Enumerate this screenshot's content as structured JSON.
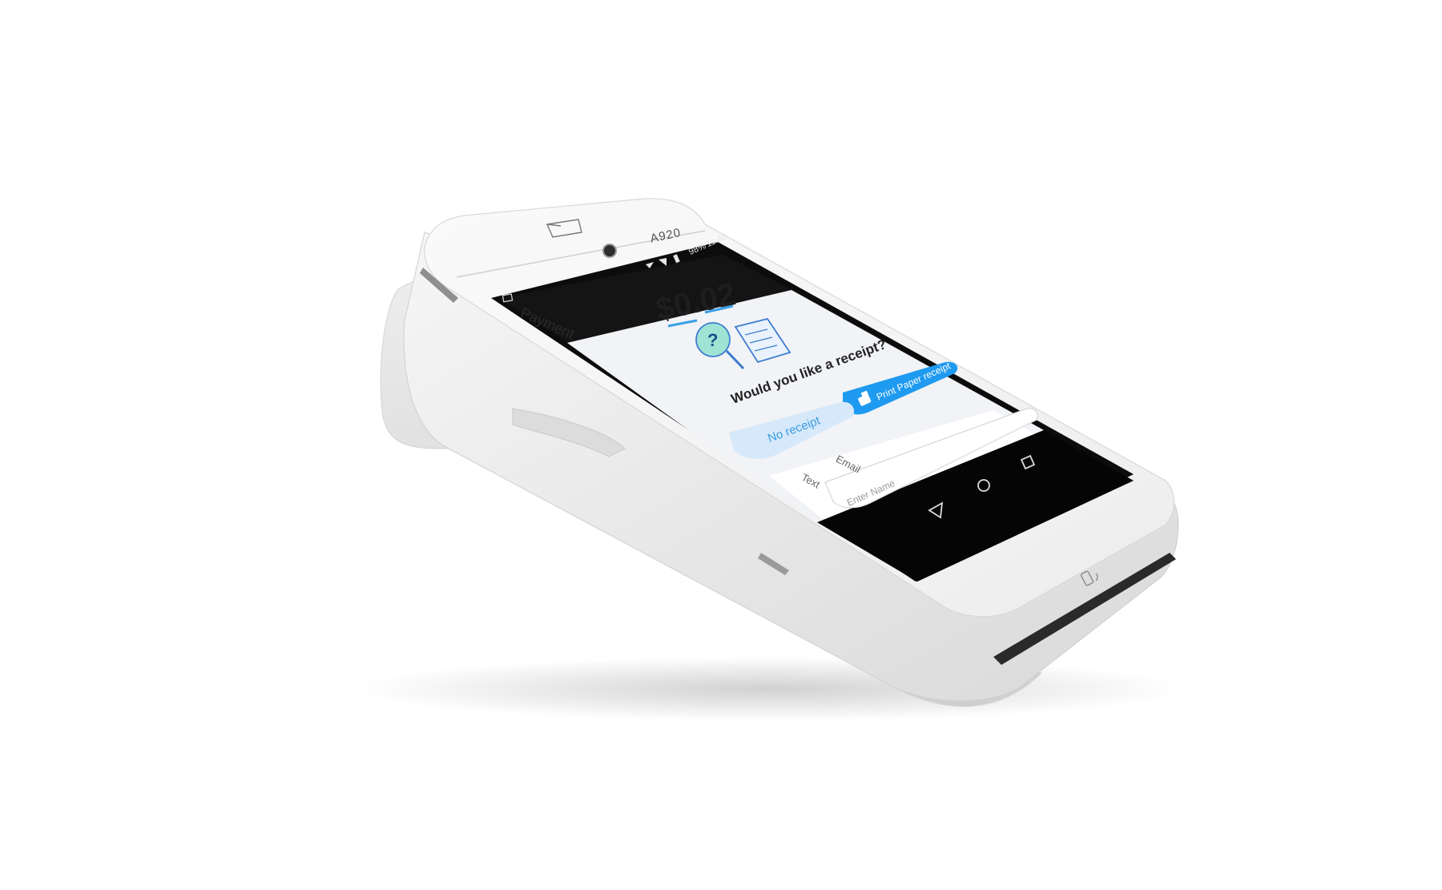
{
  "device": {
    "model": "A920",
    "accent": "#2196f3",
    "body_color": "#f2f2f2"
  },
  "status_bar": {
    "battery": "98%",
    "time": "11:40",
    "icons": [
      "wifi-icon",
      "signal-icon",
      "battery-icon"
    ]
  },
  "app": {
    "title": "Payment",
    "amount": "$0.02",
    "receipt_icon": "question-receipt-icon",
    "question": "Would you like a receipt?",
    "print_button": "Print Paper receipt",
    "no_receipt_button": "No receipt",
    "options": {
      "text_label": "Text",
      "email_label": "Email"
    },
    "name_input": {
      "placeholder": "Enter Name"
    }
  },
  "nav_bar": {
    "icons": [
      "back-icon",
      "home-icon",
      "recents-icon"
    ]
  }
}
